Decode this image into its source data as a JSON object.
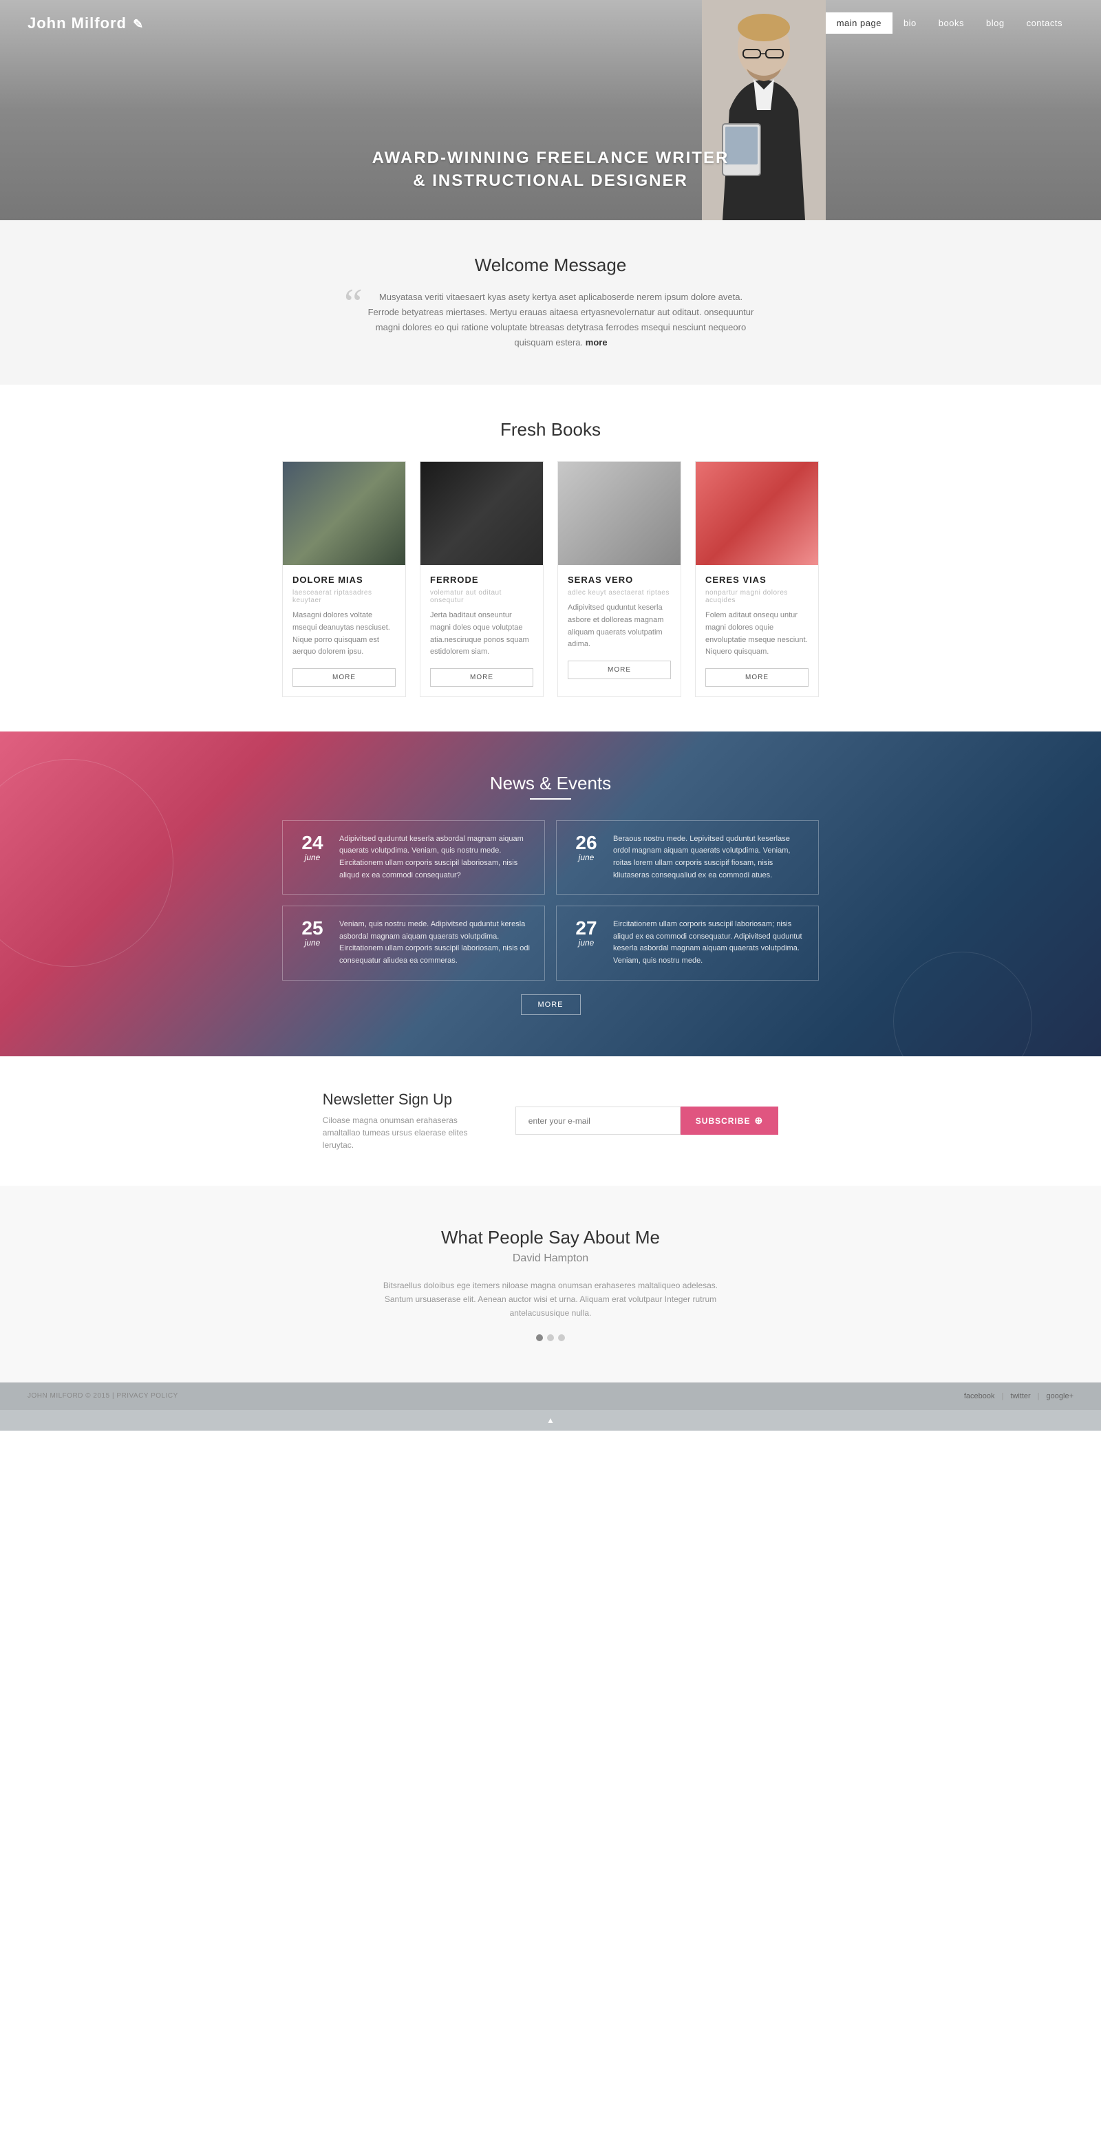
{
  "site": {
    "logo": "John Milford",
    "nav": {
      "items": [
        {
          "label": "main page",
          "active": true
        },
        {
          "label": "bio",
          "active": false
        },
        {
          "label": "books",
          "active": false
        },
        {
          "label": "blog",
          "active": false
        },
        {
          "label": "contacts",
          "active": false
        }
      ]
    }
  },
  "hero": {
    "line1": "AWARD-WINNING FREELANCE WRITER",
    "line2": "& INSTRUCTIONAL DESIGNER"
  },
  "welcome": {
    "title": "Welcome Message",
    "quote": "Musyatasa veriti vitaesaert kyas asety kertya aset aplicaboserde nerem ipsum dolore aveta. Ferrode betyatreas miertases. Mertyu erauas aitaesa ertyasnevolernatur aut oditaut. onsequuntur magni dolores eo qui ratione voluptate btreasas detytrasa ferrodes msequi nesciunt nequeoro quisquam estera.",
    "more_link": "more"
  },
  "fresh_books": {
    "title": "Fresh Books",
    "books": [
      {
        "title": "DOLORE MIAS",
        "subtitle": "laesceaerat riptasadres keuytaer",
        "desc": "Masagni dolores voltate msequi deanuytas nesciuset. Nique porro quisquam est aerquo dolorem ipsu.",
        "btn": "MORE"
      },
      {
        "title": "FERRODE",
        "subtitle": "volematur aut oditaut onsequtur",
        "desc": "Jerta baditaut onseuntur magni doles oque volutptae atia.nesciruque ponos squam estidolorem siam.",
        "btn": "MORE"
      },
      {
        "title": "SERAS VERO",
        "subtitle": "adlec keuyt asectaerat riptaes",
        "desc": "Adipivitsed quduntut keserla asbore et dolloreas magnam aliquam quaerats volutpatim adima.",
        "btn": "MORE"
      },
      {
        "title": "CERES VIAS",
        "subtitle": "nonpartur magni dolores acuqides",
        "desc": "Folem aditaut onsequ untur magni dolores oquie envoluptatie mseque nesciunt. Niquero quisquam.",
        "btn": "MORE"
      }
    ]
  },
  "news_events": {
    "title": "News & Events",
    "more_btn": "MORE",
    "events": [
      {
        "day": "24",
        "month": "june",
        "text": "Adipivitsed quduntut keserla asbordal magnam aiquam quaerats volutpdima. Veniam, quis nostru mede. Eircitationem ullam corporis suscipil laboriosam, nisis aliqud ex ea commodi consequatur?"
      },
      {
        "day": "26",
        "month": "june",
        "text": "Beraous nostru mede. Lepivitsed quduntut keserlase ordol magnam aiquam quaerats volutpdima. Veniam, roitas lorem ullam corporis suscipif fiosam, nisis kliutaseras consequaliud ex ea commodi atues."
      },
      {
        "day": "25",
        "month": "june",
        "text": "Veniam, quis nostru mede. Adipivitsed quduntut keresla asbordal magnam aiquam quaerats volutpdima. Eircitationem ullam corporis suscipil laboriosam, nisis odi consequatur aliudea ea commeras."
      },
      {
        "day": "27",
        "month": "june",
        "text": "Eircitationem ullam corporis suscipil laboriosam; nisis aliqud ex ea commodi consequatur. Adipivitsed quduntut keserla asbordal magnam aiquam quaerats volutpdima. Veniam, quis nostru mede."
      }
    ]
  },
  "newsletter": {
    "title": "Newsletter Sign Up",
    "desc": "Ciloase magna onumsan erahaseras amaltallao tumeas ursus elaerase elites leruytас.",
    "input_placeholder": "enter your e-mail",
    "btn_label": "SUBSCRIBE"
  },
  "testimonials": {
    "title": "What People Say About Me",
    "author": "David Hampton",
    "quote": "Bitsraellus doloibus ege itemers niloase magna onumsan erahaseres maltaliqueo adelesas. Santum ursuaserase elit. Aenean auctor wisi et urna. Aliquam erat volutpaur Integer rutrum antelacususique nulla.",
    "dots": [
      {
        "active": true
      },
      {
        "active": false
      },
      {
        "active": false
      }
    ]
  },
  "footer": {
    "copyright": "JOHN MILFORD © 2015 | PRIVACY POLICY",
    "social": [
      {
        "label": "facebook"
      },
      {
        "label": "twitter"
      },
      {
        "label": "google+"
      }
    ]
  }
}
